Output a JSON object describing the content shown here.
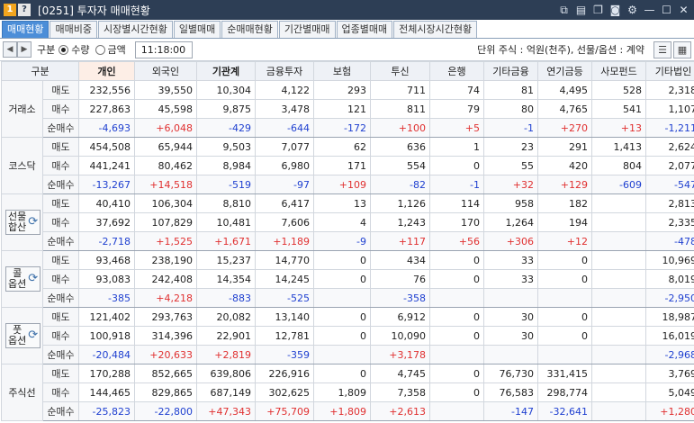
{
  "titlebar": {
    "badge_num": "1",
    "badge_q": "?",
    "title": "[0251] 투자자 매매현황"
  },
  "tabs": [
    {
      "label": "매매현황",
      "active": true
    },
    {
      "label": "매매비중",
      "active": false
    },
    {
      "label": "시장별시간현황",
      "active": false
    },
    {
      "label": "일별매매",
      "active": false
    },
    {
      "label": "순매매현황",
      "active": false
    },
    {
      "label": "기간별매매",
      "active": false
    },
    {
      "label": "업종별매매",
      "active": false
    },
    {
      "label": "전체시장시간현황",
      "active": false
    }
  ],
  "toolbar": {
    "group_label": "구분",
    "radio_qty": "수량",
    "radio_amt": "금액",
    "time": "11:18:00",
    "unit_text": "단위 주식 : 억원(천주), 선물/옵션 : 계약"
  },
  "colors": {
    "positive": "#e03030",
    "negative": "#1e3fd0",
    "active_tab": "#4c8ed8",
    "titlebar": "#2d3e55"
  },
  "table": {
    "headers": [
      "구분",
      "개인",
      "외국인",
      "기관계",
      "금융투자",
      "보험",
      "투신",
      "은행",
      "기타금융",
      "연기금등",
      "사모펀드",
      "기타법인"
    ],
    "groups": [
      {
        "name": "거래소",
        "boxed": false,
        "rows": [
          {
            "kind": "매도",
            "values": [
              "232,556",
              "39,550",
              "10,304",
              "4,122",
              "293",
              "711",
              "74",
              "81",
              "4,495",
              "528",
              "2,318"
            ]
          },
          {
            "kind": "매수",
            "values": [
              "227,863",
              "45,598",
              "9,875",
              "3,478",
              "121",
              "811",
              "79",
              "80",
              "4,765",
              "541",
              "1,107"
            ]
          },
          {
            "kind": "순매수",
            "values": [
              "-4,693",
              "+6,048",
              "-429",
              "-644",
              "-172",
              "+100",
              "+5",
              "-1",
              "+270",
              "+13",
              "-1,211"
            ]
          }
        ]
      },
      {
        "name": "코스닥",
        "boxed": false,
        "rows": [
          {
            "kind": "매도",
            "values": [
              "454,508",
              "65,944",
              "9,503",
              "7,077",
              "62",
              "636",
              "1",
              "23",
              "291",
              "1,413",
              "2,624"
            ]
          },
          {
            "kind": "매수",
            "values": [
              "441,241",
              "80,462",
              "8,984",
              "6,980",
              "171",
              "554",
              "0",
              "55",
              "420",
              "804",
              "2,077"
            ]
          },
          {
            "kind": "순매수",
            "values": [
              "-13,267",
              "+14,518",
              "-519",
              "-97",
              "+109",
              "-82",
              "-1",
              "+32",
              "+129",
              "-609",
              "-547"
            ]
          }
        ]
      },
      {
        "name": "선물\n합산",
        "boxed": true,
        "rows": [
          {
            "kind": "매도",
            "values": [
              "40,410",
              "106,304",
              "8,810",
              "6,417",
              "13",
              "1,126",
              "114",
              "958",
              "182",
              "",
              "2,813"
            ]
          },
          {
            "kind": "매수",
            "values": [
              "37,692",
              "107,829",
              "10,481",
              "7,606",
              "4",
              "1,243",
              "170",
              "1,264",
              "194",
              "",
              "2,335"
            ]
          },
          {
            "kind": "순매수",
            "values": [
              "-2,718",
              "+1,525",
              "+1,671",
              "+1,189",
              "-9",
              "+117",
              "+56",
              "+306",
              "+12",
              "",
              "-478"
            ]
          }
        ]
      },
      {
        "name": "콜\n옵션",
        "boxed": true,
        "rows": [
          {
            "kind": "매도",
            "values": [
              "93,468",
              "238,190",
              "15,237",
              "14,770",
              "0",
              "434",
              "0",
              "33",
              "0",
              "",
              "10,969"
            ]
          },
          {
            "kind": "매수",
            "values": [
              "93,083",
              "242,408",
              "14,354",
              "14,245",
              "0",
              "76",
              "0",
              "33",
              "0",
              "",
              "8,019"
            ]
          },
          {
            "kind": "순매수",
            "values": [
              "-385",
              "+4,218",
              "-883",
              "-525",
              "",
              "-358",
              "",
              "",
              "",
              "",
              "-2,950"
            ]
          }
        ]
      },
      {
        "name": "풋\n옵션",
        "boxed": true,
        "rows": [
          {
            "kind": "매도",
            "values": [
              "121,402",
              "293,763",
              "20,082",
              "13,140",
              "0",
              "6,912",
              "0",
              "30",
              "0",
              "",
              "18,987"
            ]
          },
          {
            "kind": "매수",
            "values": [
              "100,918",
              "314,396",
              "22,901",
              "12,781",
              "0",
              "10,090",
              "0",
              "30",
              "0",
              "",
              "16,019"
            ]
          },
          {
            "kind": "순매수",
            "values": [
              "-20,484",
              "+20,633",
              "+2,819",
              "-359",
              "",
              "+3,178",
              "",
              "",
              "",
              "",
              "-2,968"
            ]
          }
        ]
      },
      {
        "name": "주식선",
        "boxed": false,
        "rows": [
          {
            "kind": "매도",
            "values": [
              "170,288",
              "852,665",
              "639,806",
              "226,916",
              "0",
              "4,745",
              "0",
              "76,730",
              "331,415",
              "",
              "3,769"
            ]
          },
          {
            "kind": "매수",
            "values": [
              "144,465",
              "829,865",
              "687,149",
              "302,625",
              "1,809",
              "7,358",
              "0",
              "76,583",
              "298,774",
              "",
              "5,049"
            ]
          },
          {
            "kind": "순매수",
            "values": [
              "-25,823",
              "-22,800",
              "+47,343",
              "+75,709",
              "+1,809",
              "+2,613",
              "",
              "-147",
              "-32,641",
              "",
              "+1,280"
            ]
          }
        ]
      }
    ]
  }
}
